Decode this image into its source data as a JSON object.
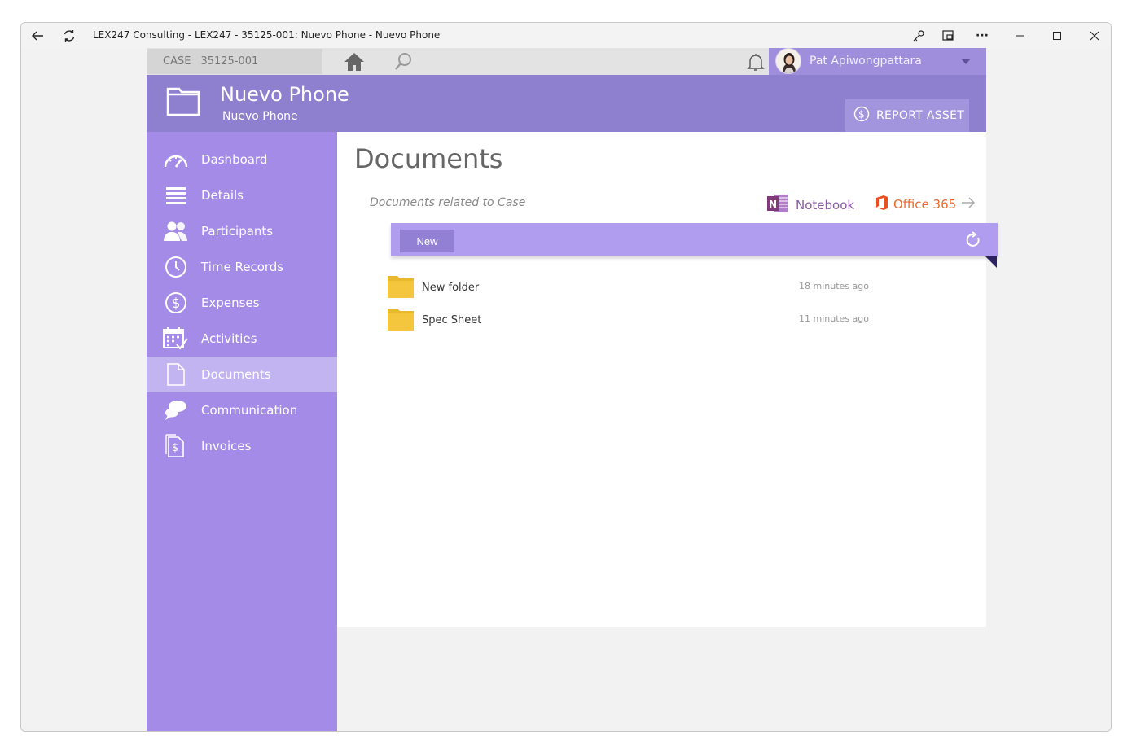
{
  "window": {
    "title": "LEX247 Consulting - LEX247 - 35125-001: Nuevo Phone - Nuevo Phone"
  },
  "topbar": {
    "case_label": "CASE",
    "case_number": "35125-001",
    "user_name": "Pat Apiwongpattara"
  },
  "header": {
    "title": "Nuevo Phone",
    "subtitle": "Nuevo Phone",
    "report_button": "REPORT ASSET"
  },
  "sidebar": {
    "items": [
      {
        "label": "Dashboard",
        "icon": "speedometer-icon"
      },
      {
        "label": "Details",
        "icon": "list-icon"
      },
      {
        "label": "Participants",
        "icon": "people-icon"
      },
      {
        "label": "Time Records",
        "icon": "clock-icon"
      },
      {
        "label": "Expenses",
        "icon": "dollar-icon"
      },
      {
        "label": "Activities",
        "icon": "calendar-icon"
      },
      {
        "label": "Documents",
        "icon": "document-icon",
        "active": true
      },
      {
        "label": "Communication",
        "icon": "chat-icon"
      },
      {
        "label": "Invoices",
        "icon": "invoice-icon"
      }
    ]
  },
  "documents": {
    "title": "Documents",
    "related_label": "Documents related to Case",
    "notebook_link": "Notebook",
    "office_link": "Office 365",
    "new_button": "New",
    "files": [
      {
        "name": "New folder",
        "time": "18 minutes ago"
      },
      {
        "name": "Spec Sheet",
        "time": "11 minutes ago"
      }
    ]
  },
  "colors": {
    "sidebar": "#a48be8",
    "header": "#8e7fcf",
    "toolbar": "#b19df0",
    "active_item": "#c2b3f1",
    "folder": "#f4c63d"
  }
}
